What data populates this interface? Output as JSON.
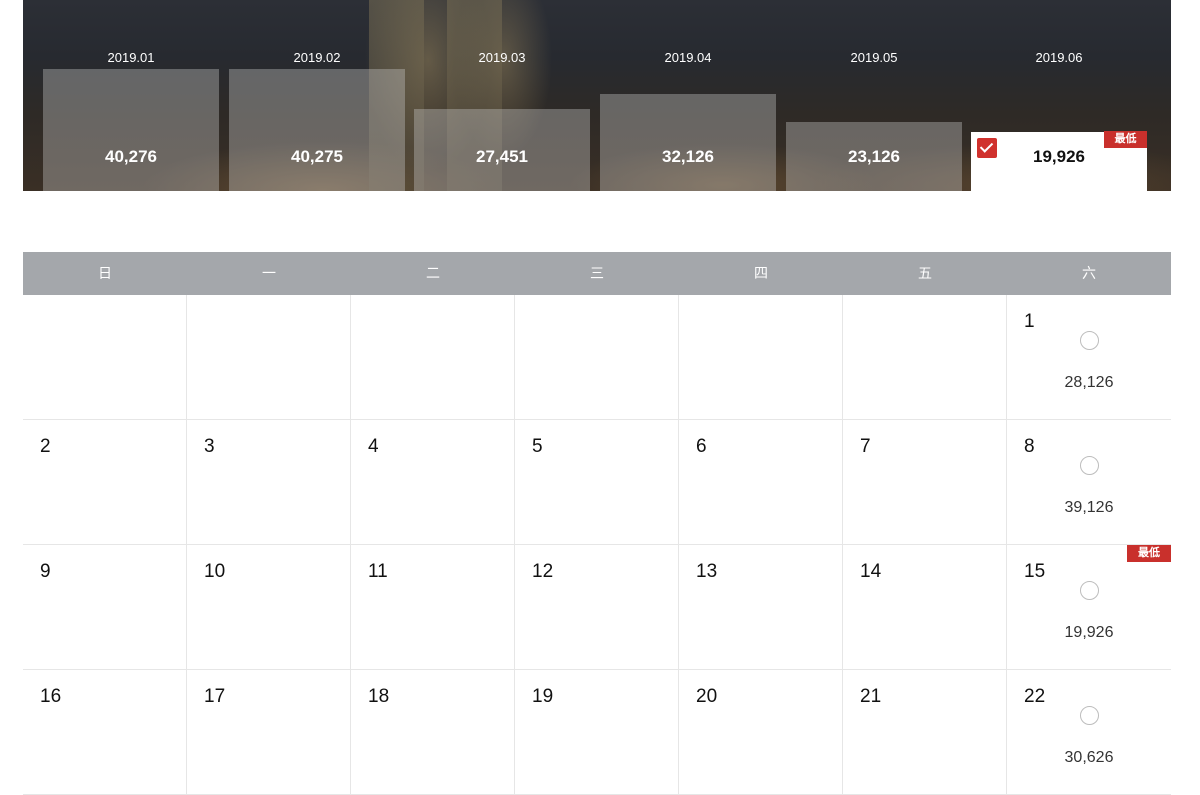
{
  "months": [
    {
      "label": "2019.01",
      "price": "40,276",
      "selected": false,
      "lowest": false,
      "bar": 0.64
    },
    {
      "label": "2019.02",
      "price": "40,275",
      "selected": false,
      "lowest": false,
      "bar": 0.64
    },
    {
      "label": "2019.03",
      "price": "27,451",
      "selected": false,
      "lowest": false,
      "bar": 0.43
    },
    {
      "label": "2019.04",
      "price": "32,126",
      "selected": false,
      "lowest": false,
      "bar": 0.51
    },
    {
      "label": "2019.05",
      "price": "23,126",
      "selected": false,
      "lowest": false,
      "bar": 0.36
    },
    {
      "label": "2019.06",
      "price": "19,926",
      "selected": true,
      "lowest": true,
      "bar": 0.31
    }
  ],
  "lowest_badge": "最低",
  "weekdays": [
    "日",
    "一",
    "二",
    "三",
    "四",
    "五",
    "六"
  ],
  "weeks": [
    [
      null,
      null,
      null,
      null,
      null,
      null,
      {
        "day": "1",
        "price": "28,126"
      }
    ],
    [
      {
        "day": "2"
      },
      {
        "day": "3"
      },
      {
        "day": "4"
      },
      {
        "day": "5"
      },
      {
        "day": "6"
      },
      {
        "day": "7"
      },
      {
        "day": "8",
        "price": "39,126"
      }
    ],
    [
      {
        "day": "9"
      },
      {
        "day": "10"
      },
      {
        "day": "11"
      },
      {
        "day": "12"
      },
      {
        "day": "13"
      },
      {
        "day": "14"
      },
      {
        "day": "15",
        "price": "19,926",
        "lowest": true
      }
    ],
    [
      {
        "day": "16"
      },
      {
        "day": "17"
      },
      {
        "day": "18"
      },
      {
        "day": "19"
      },
      {
        "day": "20"
      },
      {
        "day": "21"
      },
      {
        "day": "22",
        "price": "30,626"
      }
    ]
  ],
  "colors": {
    "accent": "#c9302c",
    "header": "#a4a7ab"
  }
}
